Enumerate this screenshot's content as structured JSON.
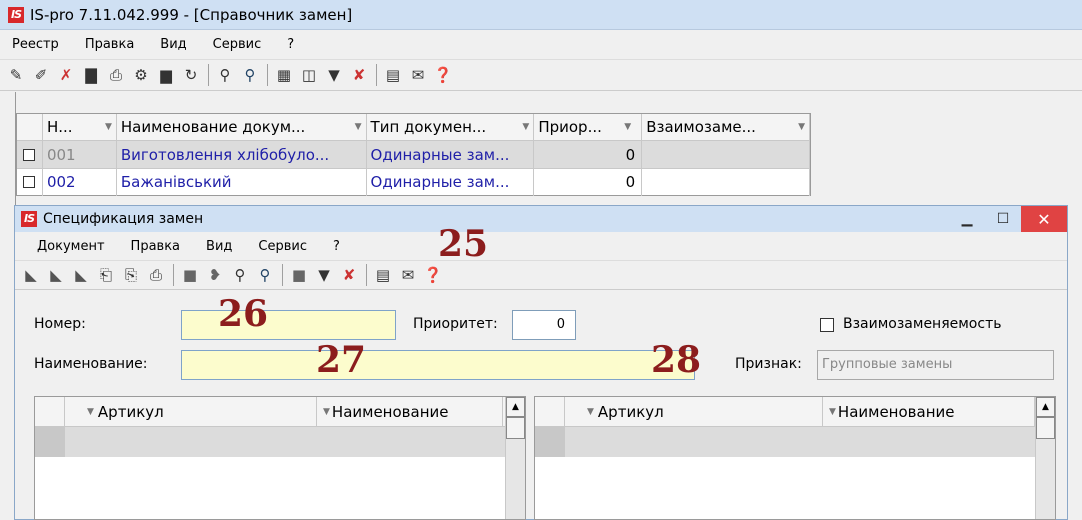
{
  "window": {
    "title": "IS-pro 7.11.042.999 - [Справочник замен]",
    "logo": "IS"
  },
  "menu": [
    "Реестр",
    "Правка",
    "Вид",
    "Сервис",
    "?"
  ],
  "toolbar_icons": [
    "new-doc-icon",
    "edit-doc-icon",
    "delete-doc-icon",
    "copy-icon",
    "print-icon",
    "tools-icon",
    "book-icon",
    "refresh-icon",
    "search-icon",
    "search-next-icon",
    "table-icon",
    "layout-icon",
    "filter-icon",
    "clear-filter-icon",
    "form-icon",
    "mail-icon",
    "help-icon"
  ],
  "grid": {
    "columns": [
      "Н...",
      "Наименование докум...",
      "Тип докумен...",
      "Приор...",
      "Взаимозаме..."
    ],
    "rows": [
      {
        "num": "001",
        "name": "Виготовлення хлібобуло...",
        "type": "Одинарные зам...",
        "priority": "0",
        "mutual": ""
      },
      {
        "num": "002",
        "name": "Бажанівський",
        "type": "Одинарные зам...",
        "priority": "0",
        "mutual": ""
      }
    ]
  },
  "subwindow": {
    "title": "Спецификация замен",
    "logo": "IS",
    "menu": [
      "Документ",
      "Правка",
      "Вид",
      "Сервис",
      "?"
    ],
    "form": {
      "number_label": "Номер:",
      "number_value": "",
      "priority_label": "Приоритет:",
      "priority_value": "0",
      "mutual_label": "Взаимозаменяемость",
      "name_label": "Наименование:",
      "name_value": "",
      "sign_label": "Признак:",
      "sign_value": "Групповые замены"
    },
    "left_pane": {
      "columns": [
        "Артикул",
        "Наименование"
      ]
    },
    "right_pane": {
      "columns": [
        "Артикул",
        "Наименование"
      ]
    }
  },
  "annotations": [
    "25",
    "26",
    "27",
    "28"
  ],
  "colors": {
    "title_bar": "#cfe0f3",
    "input_yellow": "#fcfccd",
    "badge": "#8c1d1d",
    "close": "#e04343",
    "link_blue": "#1f1fa8"
  }
}
